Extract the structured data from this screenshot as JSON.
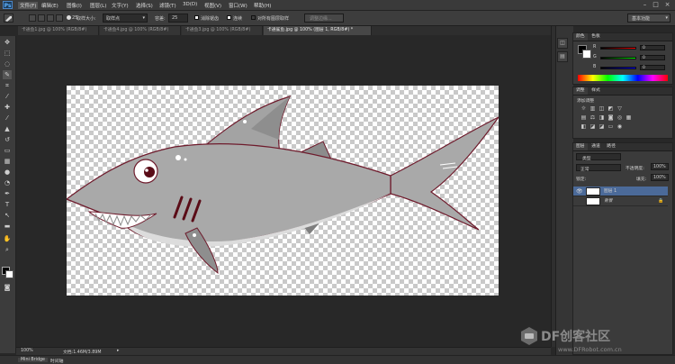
{
  "app": {
    "logo": "Ps"
  },
  "menu": [
    "文件(F)",
    "编辑(E)",
    "图像(I)",
    "图层(L)",
    "文字(Y)",
    "选择(S)",
    "滤镜(T)",
    "3D(D)",
    "视图(V)",
    "窗口(W)",
    "帮助(H)"
  ],
  "options": {
    "brush_size": "25",
    "sample_label": "取样大小:",
    "sample_value": "取样点",
    "tolerance_label": "容差:",
    "tolerance_value": "25",
    "antialias": "消除锯齿",
    "contiguous": "连续",
    "all_layers": "对所有图层取样",
    "refine_edge": "调整边缘...",
    "workspace": "基本功能"
  },
  "tabs": [
    {
      "label": "卡通鱼1.jpg @ 100% (RGB/8#)",
      "active": false
    },
    {
      "label": "卡通鱼4.jpg @ 100% (RGB/8#)",
      "active": false
    },
    {
      "label": "卡通鱼3.jpg @ 100% (RGB/8#)",
      "active": false
    },
    {
      "label": "卡通鲨鱼.jpg @ 100% (图层 1, RGB/8#) *",
      "active": true
    }
  ],
  "status": {
    "zoom": "100%",
    "doc": "文档:1.46M/3.89M"
  },
  "bottom": {
    "mini_bridge": "Mini Bridge",
    "timeline": "时间轴"
  },
  "color_panel": {
    "tabs": [
      "颜色",
      "色板"
    ],
    "r": "0",
    "g": "0",
    "b": "0",
    "r_label": "R",
    "g_label": "G",
    "b_label": "B"
  },
  "adjust_panel": {
    "tabs": [
      "调整",
      "样式"
    ],
    "title": "添加调整"
  },
  "layers_panel": {
    "tabs": [
      "图层",
      "通道",
      "路径"
    ],
    "kind": "类型",
    "blend": "正常",
    "opacity_label": "不透明度:",
    "opacity": "100%",
    "lock_label": "锁定:",
    "fill_label": "填充:",
    "fill": "100%",
    "layers": [
      {
        "name": "图层 1",
        "selected": true
      },
      {
        "name": "背景",
        "selected": false
      }
    ]
  },
  "watermark": {
    "brand": "DF创客社区",
    "url": "www.DFRobot.com.cn"
  },
  "colors": {
    "accent": "#4a79c4",
    "shark_body": "#a9a9a9",
    "shark_outline": "#6e1b2c"
  }
}
